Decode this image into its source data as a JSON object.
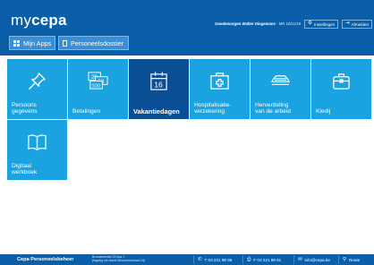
{
  "header": {
    "logo_prefix": "my",
    "logo_brand": "cepa",
    "greeting": "Goedemorgen",
    "user_name": "Walter Dingemans",
    "version": " - MR 10/11/19",
    "settings_label": "Instellingen",
    "logout_label": "Afmelden"
  },
  "nav": {
    "apps_label": "Mijn Apps",
    "dossier_label": "Personeelsdossier"
  },
  "tiles": [
    {
      "label_1": "Persoons",
      "label_2": "gegevens",
      "icon": "pin-icon"
    },
    {
      "label_1": "Betalingen",
      "label_2": "",
      "icon": "banknotes-icon",
      "note_1": "20",
      "note_2": "50",
      "note_3": "100"
    },
    {
      "label_1": "Vakantiedagen",
      "label_2": "",
      "icon": "calendar-icon",
      "day": "16"
    },
    {
      "label_1": "Hospitalisatie-",
      "label_2": "verzekering",
      "icon": "medical-kit-icon"
    },
    {
      "label_1": "Herverdeling",
      "label_2": "van de arbeid",
      "icon": "balance-stack-icon"
    },
    {
      "label_1": "Kledij",
      "label_2": "",
      "icon": "suitcase-icon"
    },
    {
      "label_1": "Digitaal",
      "label_2": "werkboek",
      "icon": "open-book-icon"
    }
  ],
  "footer": {
    "org": "Cepa Personeelsbeheer",
    "address": "Brouwersvliet 33 bus 7",
    "address_note": "(ingang via Astrid Brouwersstraat 24)",
    "tel": "T 03 221 98 86",
    "fax": "F 03 221 98 61",
    "email": "info@cepa.be",
    "route": "Route"
  },
  "colors": {
    "header_bg": "#0b5fa8",
    "tile_bg": "#1aa3e0",
    "tile_active_bg": "#0a4f96"
  }
}
